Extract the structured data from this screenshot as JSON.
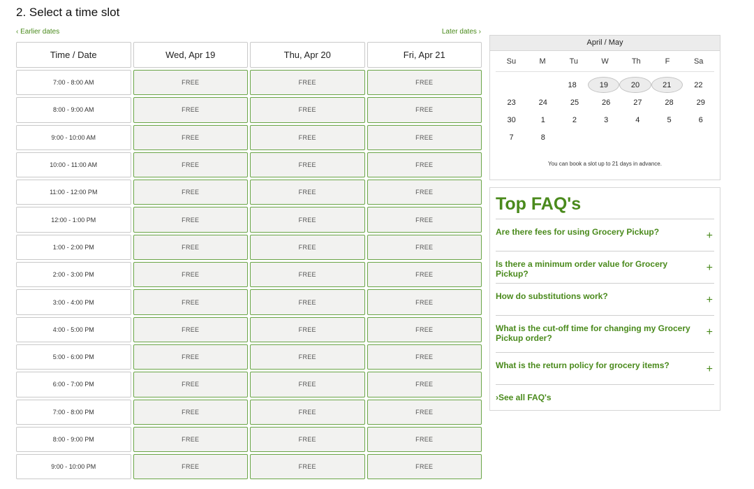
{
  "page": {
    "title": "2. Select a time slot"
  },
  "nav": {
    "prev": "‹ Earlier dates",
    "next": "Later dates ›"
  },
  "grid": {
    "header": [
      "Time / Date",
      "Wed, Apr 19",
      "Thu, Apr 20",
      "Fri, Apr 21"
    ],
    "slot_label": "FREE",
    "times": [
      "7:00 - 8:00 AM",
      "8:00 - 9:00 AM",
      "9:00 - 10:00 AM",
      "10:00 - 11:00 AM",
      "11:00 - 12:00 PM",
      "12:00 - 1:00 PM",
      "1:00 - 2:00 PM",
      "2:00 - 3:00 PM",
      "3:00 - 4:00 PM",
      "4:00 - 5:00 PM",
      "5:00 - 6:00 PM",
      "6:00 - 7:00 PM",
      "7:00 - 8:00 PM",
      "8:00 - 9:00 PM",
      "9:00 - 10:00 PM"
    ]
  },
  "calendar": {
    "title": "April / May",
    "weekdays": [
      "Su",
      "M",
      "Tu",
      "W",
      "Th",
      "F",
      "Sa"
    ],
    "weeks": [
      [
        "",
        "",
        "18",
        "19",
        "20",
        "21",
        "22"
      ],
      [
        "23",
        "24",
        "25",
        "26",
        "27",
        "28",
        "29"
      ],
      [
        "30",
        "1",
        "2",
        "3",
        "4",
        "5",
        "6"
      ],
      [
        "7",
        "8",
        "",
        "",
        "",
        "",
        ""
      ]
    ],
    "available_days": [
      "19",
      "20",
      "21"
    ],
    "note": "You can book a slot up to 21 days in advance."
  },
  "faq": {
    "title": "Top FAQ's",
    "items": [
      "Are there fees for using Grocery Pickup?",
      "Is there a minimum order value for Grocery Pickup?",
      "How do substitutions work?",
      "What is the cut-off time for changing my Grocery Pickup order?",
      "What is the return policy for grocery items?"
    ],
    "see_all": "›See all FAQ's"
  },
  "colors": {
    "accent": "#4a8a1c",
    "slot_border": "#6aa547",
    "slot_bg": "#f2f2f0"
  },
  "icons": {
    "expand": "plus-icon"
  }
}
